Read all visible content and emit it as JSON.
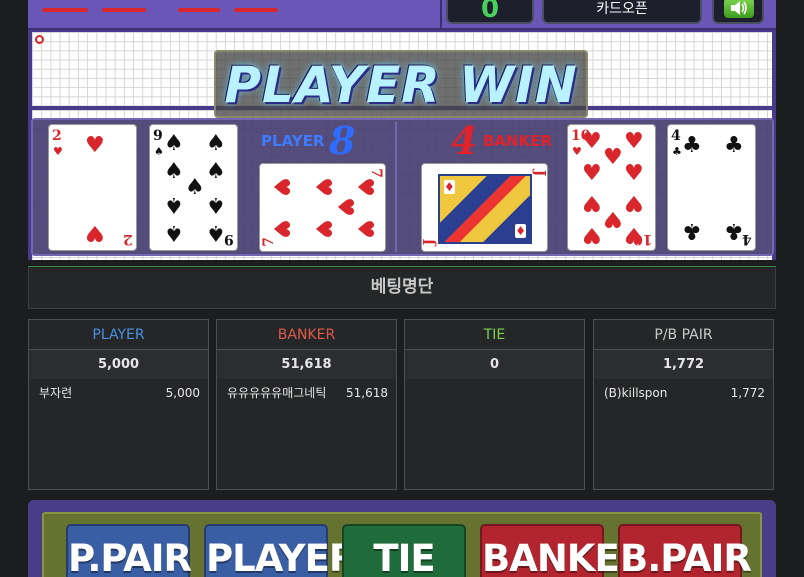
{
  "topbar": {
    "count_value": "0",
    "card_label": "카드오픈"
  },
  "result_banner": "PLAYER WIN",
  "player": {
    "label": "PLAYER",
    "score": "8"
  },
  "banker": {
    "label": "BANKER",
    "score": "4"
  },
  "cards": {
    "player": [
      {
        "rank": "2",
        "suit": "♥",
        "color": "red"
      },
      {
        "rank": "9",
        "suit": "♠",
        "color": "black"
      },
      {
        "rank": "7",
        "suit": "♥",
        "color": "red",
        "rotated": true
      }
    ],
    "banker": [
      {
        "rank": "J",
        "suit": "♦",
        "color": "red",
        "rotated": true
      },
      {
        "rank": "10",
        "suit": "♥",
        "color": "red"
      },
      {
        "rank": "4",
        "suit": "♣",
        "color": "black"
      }
    ]
  },
  "bet_list_title": "베팅명단",
  "bet_columns": [
    {
      "header": "PLAYER",
      "header_color": "#4a90e2",
      "total": "5,000",
      "rows": [
        {
          "name": "부자련",
          "amount": "5,000"
        }
      ]
    },
    {
      "header": "BANKER",
      "header_color": "#e0584a",
      "total": "51,618",
      "rows": [
        {
          "name": "유유유유유매그네틱",
          "amount": "51,618"
        }
      ]
    },
    {
      "header": "TIE",
      "header_color": "#7fd14c",
      "total": "0",
      "rows": []
    },
    {
      "header": "P/B PAIR",
      "header_color": "#c9c9c9",
      "total": "1,772",
      "rows": [
        {
          "name": "(B)killspon",
          "amount": "1,772"
        }
      ]
    }
  ],
  "bet_buttons": [
    {
      "label": "P.PAIR",
      "color": "#3a5ea4"
    },
    {
      "label": "PLAYER",
      "color": "#3a5ea4"
    },
    {
      "label": "TIE",
      "color": "#1f6b3a"
    },
    {
      "label": "BANKER",
      "color": "#b3252e"
    },
    {
      "label": "B.PAIR",
      "color": "#b3252e"
    }
  ]
}
